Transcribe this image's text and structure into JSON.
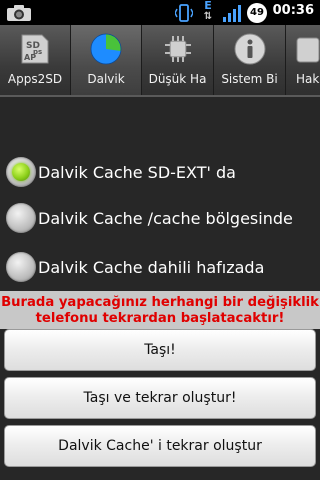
{
  "status_bar": {
    "time": "00:36",
    "battery_level": "49",
    "icons": [
      "camera-icon",
      "vibrate-icon",
      "edge-data-icon",
      "signal-icon",
      "battery-icon"
    ],
    "network_letter": "E"
  },
  "tabs": [
    {
      "label": "Apps2SD",
      "icon": "apps2sd-icon",
      "icon_text": "SD\nAPPs"
    },
    {
      "label": "Dalvik",
      "icon": "pie-chart-icon",
      "selected": true
    },
    {
      "label": "Düşük Ha",
      "icon": "chip-icon"
    },
    {
      "label": "Sistem Bi",
      "icon": "info-icon"
    },
    {
      "label": "Hak",
      "icon": "partial-icon"
    }
  ],
  "options": [
    {
      "label": "Dalvik Cache SD-EXT' da",
      "checked": true
    },
    {
      "label": "Dalvik Cache /cache bölgesinde",
      "checked": false
    },
    {
      "label": "Dalvik Cache dahili hafızada",
      "checked": false
    }
  ],
  "warning": {
    "line1": "Burada yapacağınız herhangi bir değişiklik",
    "line2": "telefonu tekrardan başlatacaktır!"
  },
  "buttons": {
    "move": "Taşı!",
    "move_recreate": "Taşı ve tekrar oluştur!",
    "recreate": "Dalvik Cache' i tekrar oluştur"
  },
  "colors": {
    "warning_text": "#e00000",
    "selected_radio": "#8ed11c"
  }
}
